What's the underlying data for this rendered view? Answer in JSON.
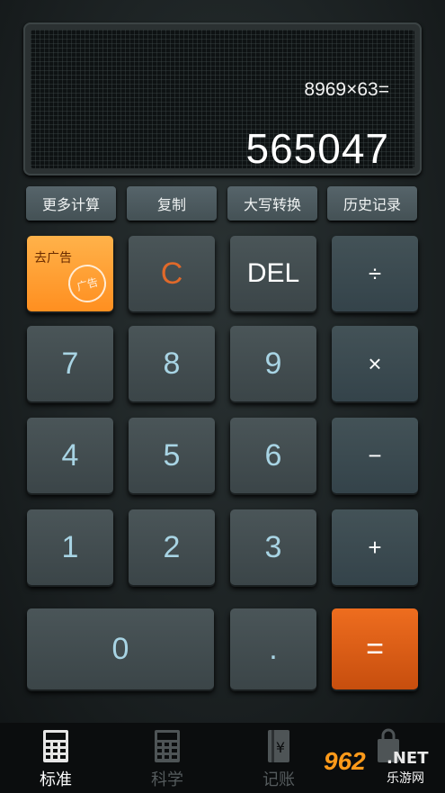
{
  "display": {
    "expression": "8969×63=",
    "result": "565047"
  },
  "function_bar": [
    {
      "label": "更多计算"
    },
    {
      "label": "复制"
    },
    {
      "label": "大写转换"
    },
    {
      "label": "历史记录"
    }
  ],
  "keys": {
    "ad": {
      "label": "去广告",
      "badge": "广告"
    },
    "clear": "C",
    "delete": "DEL",
    "divide": "÷",
    "multiply": "×",
    "minus": "−",
    "plus": "+",
    "equals": "=",
    "dot": ".",
    "zero": "0",
    "one": "1",
    "two": "2",
    "three": "3",
    "four": "4",
    "five": "5",
    "six": "6",
    "seven": "7",
    "eight": "8",
    "nine": "9"
  },
  "nav": [
    {
      "label": "标准",
      "icon": "calculator-icon",
      "active": true
    },
    {
      "label": "科学",
      "icon": "scientific-calculator-icon",
      "active": false
    },
    {
      "label": "记账",
      "icon": "yen-ledger-icon",
      "active": false
    },
    {
      "label": "",
      "icon": "shopping-bag-icon",
      "active": false
    }
  ],
  "watermark": {
    "number": "962",
    "net": ".NET",
    "sub": "乐游网"
  },
  "colors": {
    "accent_orange": "#e0692a",
    "ad_key": "#ffa034",
    "equals_key": "#e0621a",
    "digit_text": "#a8d4e4"
  }
}
